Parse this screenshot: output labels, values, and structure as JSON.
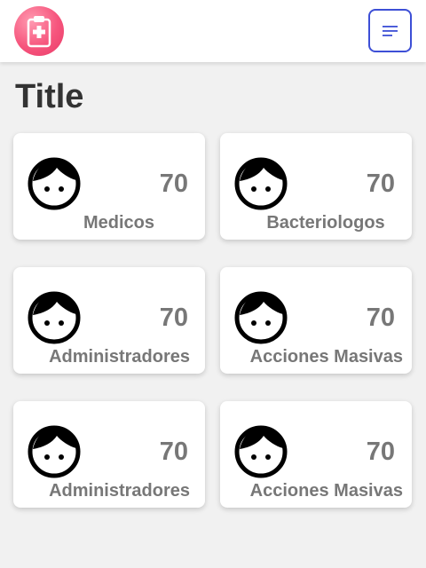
{
  "header": {
    "logo_icon": "clipboard-medical-icon",
    "menu_icon": "menu-lines-icon",
    "accent_color": "#3d4fd6",
    "logo_color": "#f6557d"
  },
  "page": {
    "title": "Title"
  },
  "cards": [
    {
      "icon": "face-icon",
      "count": "70",
      "label": "Medicos"
    },
    {
      "icon": "face-icon",
      "count": "70",
      "label": "Bacteriologos"
    },
    {
      "icon": "face-icon",
      "count": "70",
      "label": "Administradores"
    },
    {
      "icon": "face-icon",
      "count": "70",
      "label": "Acciones Masivas"
    },
    {
      "icon": "face-icon",
      "count": "70",
      "label": "Administradores"
    },
    {
      "icon": "face-icon",
      "count": "70",
      "label": "Acciones Masivas"
    }
  ]
}
